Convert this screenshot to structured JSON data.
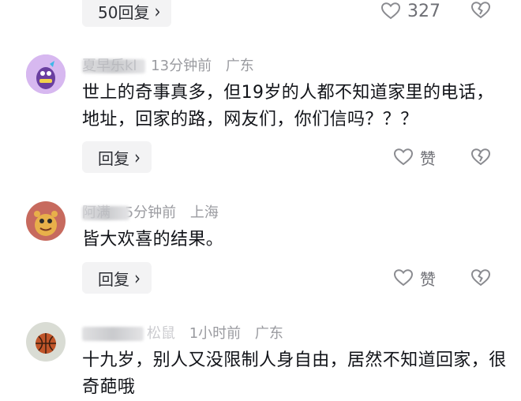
{
  "comments": [
    {
      "reply_button_label": "50回复",
      "like_count": "327"
    },
    {
      "user_name": "夏早乐kl",
      "time": "13分钟前",
      "location": "广东",
      "text": "世上的奇事真多，但19岁的人都不知道家里的电话，地址，回家的路，网友们，你们信吗？？？",
      "reply_button_label": "回复",
      "like_label": "赞"
    },
    {
      "user_name": "阿满",
      "time": "5分钟前",
      "location": "上海",
      "text": "皆大欢喜的结果。",
      "reply_button_label": "回复",
      "like_label": "赞"
    },
    {
      "user_name": "松鼠",
      "time": "1小时前",
      "location": "广东",
      "text": "十九岁，别人又没限制人身自由，居然不知道回家，很奇葩哦"
    }
  ],
  "icons": {
    "like": "heart-outline-icon",
    "dislike": "broken-heart-icon",
    "reply_chevron": "chevron-right-icon"
  }
}
